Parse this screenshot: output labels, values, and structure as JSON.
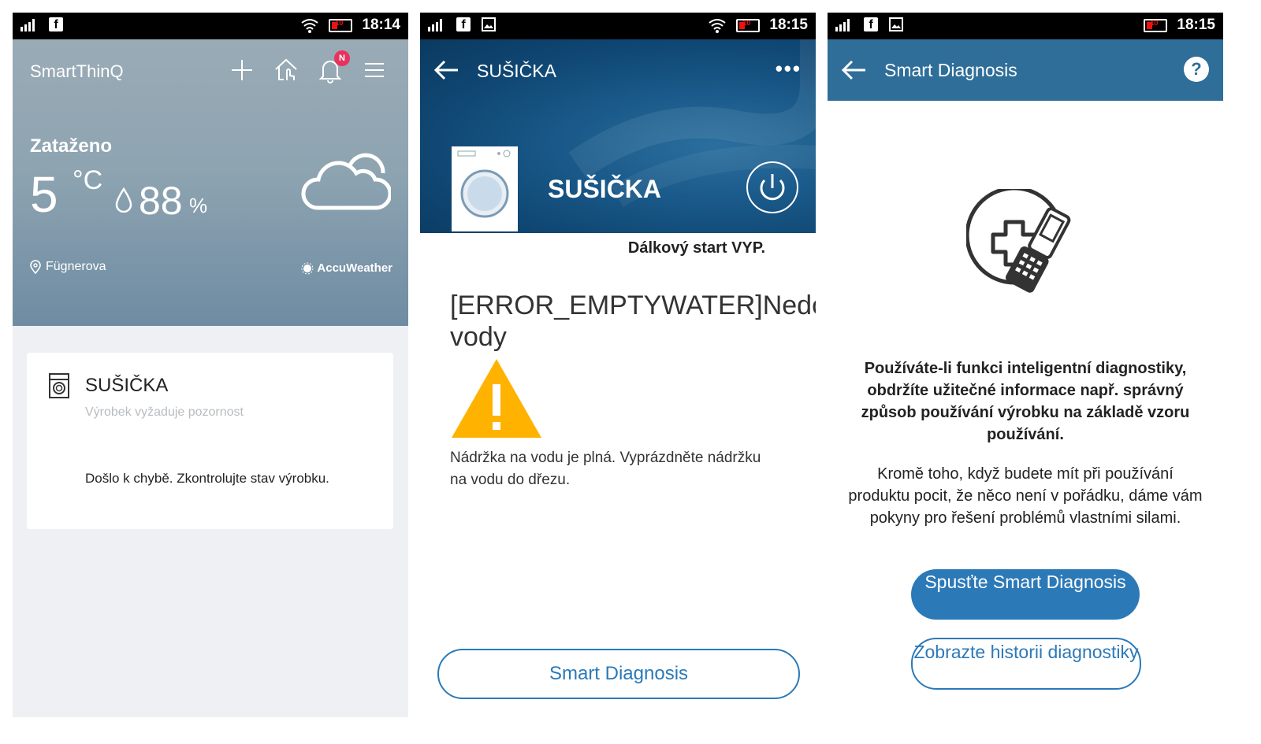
{
  "screen1": {
    "status": {
      "time": "18:14",
      "battery": "10"
    },
    "app_title": "SmartThinQ",
    "notification_badge": "N",
    "weather": {
      "condition": "Zataženo",
      "temperature": "5",
      "temp_unit": "°C",
      "humidity": "88",
      "humidity_unit": "%",
      "location": "Fügnerova",
      "provider": "AccuWeather"
    },
    "device_card": {
      "name": "SUŠIČKA",
      "subtitle": "Výrobek vyžaduje pozornost",
      "message": "Došlo k chybě. Zkontrolujte stav výrobku."
    }
  },
  "screen2": {
    "status": {
      "time": "18:15",
      "battery": "10"
    },
    "header_title": "SUŠIČKA",
    "more_label": "•••",
    "device_name": "SUŠIČKA",
    "remote_status": "Dálkový start VYP.",
    "error_title": "[ERROR_EMPTYWATER]Nedostatek vody",
    "error_desc": "Nádržka na vodu je plná. Vyprázdněte nádržku na vodu do dřezu.",
    "smart_diagnosis_button": "Smart Diagnosis"
  },
  "screen3": {
    "status": {
      "time": "18:15",
      "battery": "10"
    },
    "header_title": "Smart Diagnosis",
    "help_label": "?",
    "paragraph_bold": "Používáte-li funkci inteligentní diagnostiky, obdržíte užitečné informace např. správný způsob používání výrobku na základě vzoru používání.",
    "paragraph": "Kromě toho, když budete mít při používání produktu pocit, že něco není v pořádku, dáme vám pokyny pro řešení problémů vlastními silami.",
    "start_button": "Spusťte Smart Diagnosis",
    "history_button": "Zobrazte historii diagnostiky"
  },
  "colors": {
    "accent": "#2c79b7",
    "header_blue": "#2f6e99",
    "warning": "#ffb300",
    "badge": "#e6335e"
  }
}
